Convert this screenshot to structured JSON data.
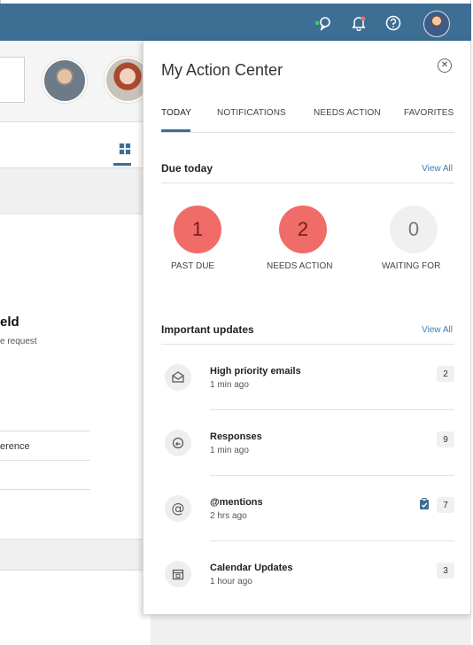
{
  "topbar": {
    "icons": [
      "chat-icon",
      "bell-icon",
      "help-icon"
    ],
    "accent": "#3d6e93",
    "status_dot": "#45c46f"
  },
  "background_app": {
    "title": "eld",
    "subtitle": "e request",
    "field": "erence"
  },
  "action_center": {
    "title": "My Action Center",
    "close_icon": "close-icon",
    "tabs": [
      {
        "label": "TODAY",
        "active": true
      },
      {
        "label": "NOTIFICATIONS",
        "active": false
      },
      {
        "label": "NEEDS ACTION",
        "active": false
      },
      {
        "label": "FAVORITES",
        "active": false
      }
    ],
    "due_today": {
      "label": "Due today",
      "view_all": "View All",
      "counters": [
        {
          "value": "1",
          "label": "PAST DUE",
          "color": "#ef6c68"
        },
        {
          "value": "2",
          "label": "NEEDS ACTION",
          "color": "#ef6c68"
        },
        {
          "value": "0",
          "label": "WAITING FOR",
          "color": "#f0f0f0"
        }
      ]
    },
    "important_updates": {
      "label": "Important updates",
      "view_all": "View All",
      "items": [
        {
          "icon": "envelope-icon",
          "title": "High priority emails",
          "time": "1 min ago",
          "count": "2"
        },
        {
          "icon": "reply-icon",
          "title": "Responses",
          "time": "1 min ago",
          "count": "9"
        },
        {
          "icon": "at-sign-icon",
          "title": "@mentions",
          "time": "2 hrs ago",
          "count": "7",
          "flag": "clipboard-check-icon"
        },
        {
          "icon": "calendar-icon",
          "title": "Calendar Updates",
          "time": "1 hour ago",
          "count": "3"
        }
      ]
    }
  }
}
